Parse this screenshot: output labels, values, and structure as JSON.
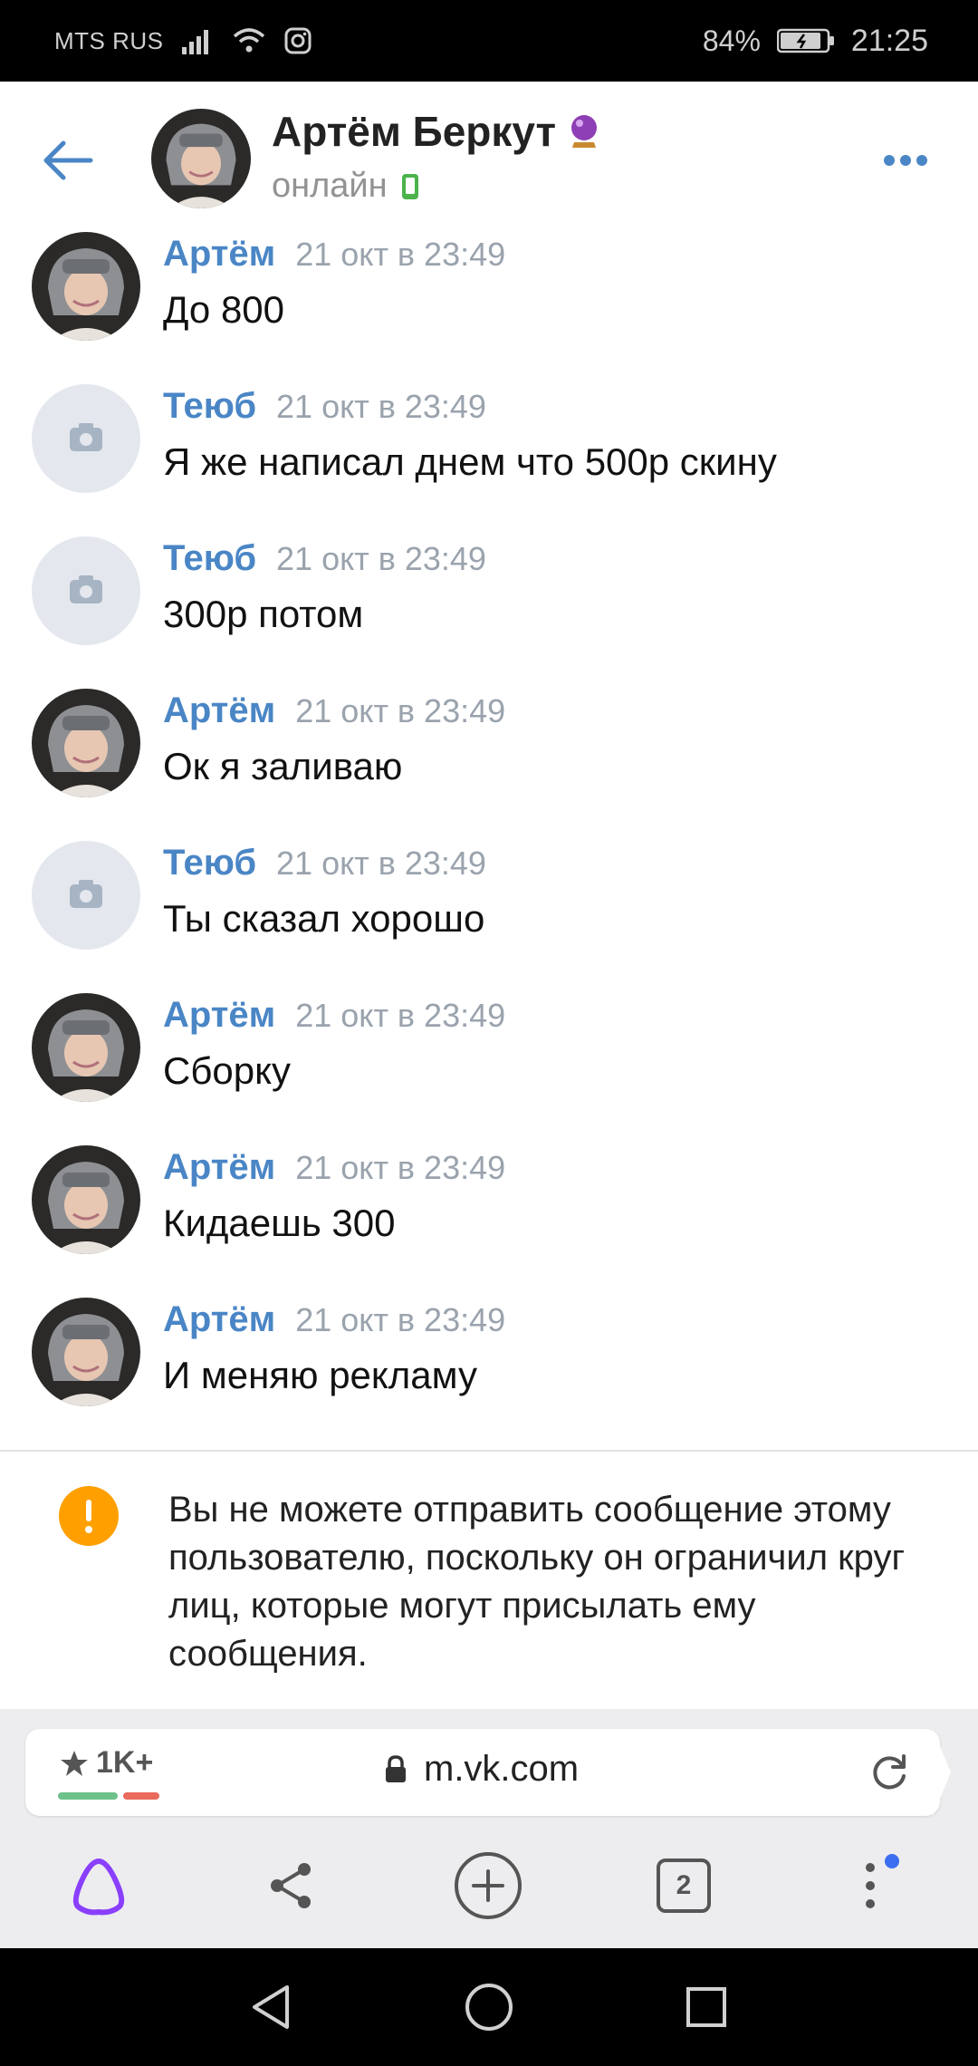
{
  "status_bar": {
    "carrier": "MTS RUS",
    "battery": "84%",
    "time": "21:25"
  },
  "header": {
    "name": "Артём Беркут",
    "status": "онлайн",
    "icons": [
      "back-arrow-icon",
      "crystal-ball-icon",
      "mobile-online-icon",
      "more-icon"
    ]
  },
  "messages": [
    {
      "author": "Артём",
      "time": "21 окт в 23:49",
      "text": "До 800",
      "avatar": "photo"
    },
    {
      "author": "Теюб",
      "time": "21 окт в 23:49",
      "text": "Я же написал днем что 500р скину",
      "avatar": "camera-placeholder"
    },
    {
      "author": "Теюб",
      "time": "21 окт в 23:49",
      "text": "300р потом",
      "avatar": "camera-placeholder"
    },
    {
      "author": "Артём",
      "time": "21 окт в 23:49",
      "text": "Ок я заливаю",
      "avatar": "photo"
    },
    {
      "author": "Теюб",
      "time": "21 окт в 23:49",
      "text": "Ты сказал хорошо",
      "avatar": "camera-placeholder"
    },
    {
      "author": "Артём",
      "time": "21 окт в 23:49",
      "text": "Сборку",
      "avatar": "photo"
    },
    {
      "author": "Артём",
      "time": "21 окт в 23:49",
      "text": "Кидаешь 300",
      "avatar": "photo"
    },
    {
      "author": "Артём",
      "time": "21 окт в 23:49",
      "text": "И меняю рекламу",
      "avatar": "photo"
    }
  ],
  "warning": {
    "text": "Вы не можете отправить сообщение этому пользователю, поскольку он ограничил круг лиц, которые могут присылать ему сообщения."
  },
  "browser": {
    "rating": "1K+",
    "url": "m.vk.com",
    "tabs_count": "2"
  },
  "colors": {
    "author_link": "#4a86c6",
    "warning": "#ffa000",
    "online": "#4bb34b",
    "alice": "#8a3ffc"
  }
}
